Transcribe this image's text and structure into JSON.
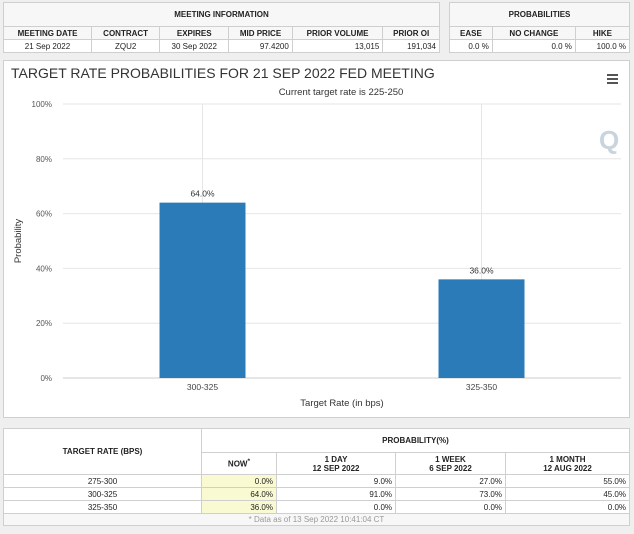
{
  "meeting": {
    "title": "MEETING INFORMATION",
    "headers": [
      "MEETING DATE",
      "CONTRACT",
      "EXPIRES",
      "MID PRICE",
      "PRIOR VOLUME",
      "PRIOR OI"
    ],
    "values": [
      "21 Sep 2022",
      "ZQU2",
      "30 Sep 2022",
      "97.4200",
      "13,015",
      "191,034"
    ]
  },
  "probabilities": {
    "title": "PROBABILITIES",
    "headers": [
      "EASE",
      "NO CHANGE",
      "HIKE"
    ],
    "values": [
      "0.0 %",
      "0.0 %",
      "100.0 %"
    ]
  },
  "chart_data": {
    "type": "bar",
    "title": "TARGET RATE PROBABILITIES FOR 21 SEP 2022 FED MEETING",
    "subtitle": "Current target rate is 225-250",
    "xlabel": "Target Rate (in bps)",
    "ylabel": "Probability",
    "categories": [
      "300-325",
      "325-350"
    ],
    "values": [
      64.0,
      36.0
    ],
    "data_labels": [
      "64.0%",
      "36.0%"
    ],
    "ylim": [
      0,
      100
    ],
    "yticks": [
      "0%",
      "20%",
      "40%",
      "60%",
      "80%",
      "100%"
    ],
    "grid": true,
    "color": "#2b7bb9"
  },
  "table": {
    "rate_header": "TARGET RATE (BPS)",
    "prob_header": "PROBABILITY(%)",
    "cols": [
      {
        "l1": "NOW",
        "l2": "*"
      },
      {
        "l1": "1 DAY",
        "l2": "12 SEP 2022"
      },
      {
        "l1": "1 WEEK",
        "l2": "6 SEP 2022"
      },
      {
        "l1": "1 MONTH",
        "l2": "12 AUG 2022"
      }
    ],
    "rows": [
      [
        "275-300",
        "0.0%",
        "9.0%",
        "27.0%",
        "55.0%"
      ],
      [
        "300-325",
        "64.0%",
        "91.0%",
        "73.0%",
        "45.0%"
      ],
      [
        "325-350",
        "36.0%",
        "0.0%",
        "0.0%",
        "0.0%"
      ]
    ],
    "footnote": "* Data as of 13 Sep 2022 10:41:04 CT"
  },
  "icons": {
    "menu": "hamburger-menu-icon",
    "logo": "q-logo-icon"
  }
}
